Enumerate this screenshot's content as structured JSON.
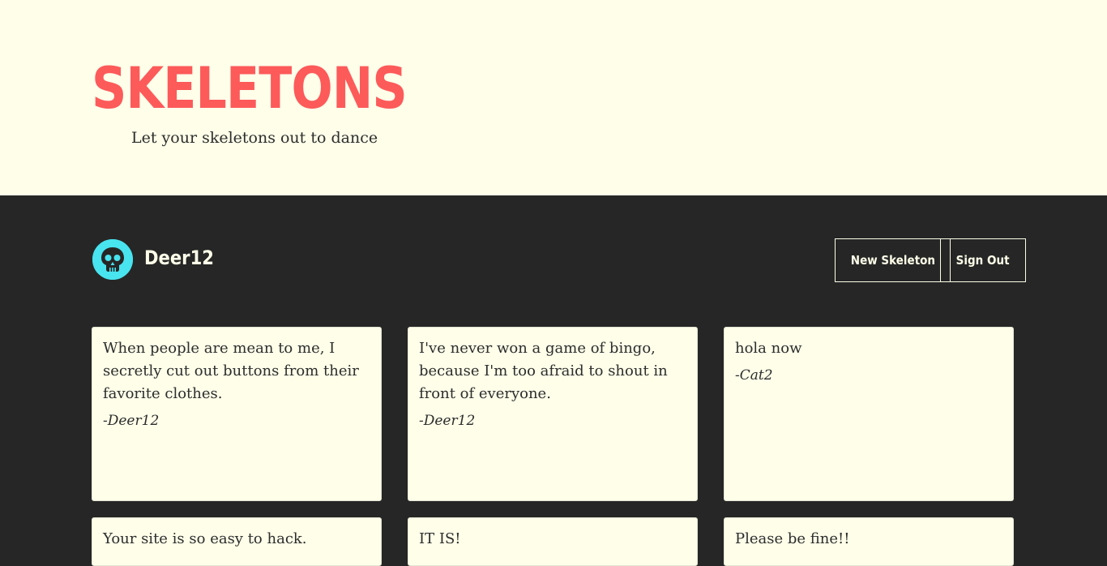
{
  "header": {
    "title": "SKELETONS",
    "tagline": "Let your skeletons out to dance"
  },
  "user": {
    "name": "Deer12",
    "avatar_icon": "skull-icon",
    "avatar_color": "#48e4f0"
  },
  "actions": {
    "new_skeleton": "New Skeleton",
    "sign_out": "Sign Out"
  },
  "colors": {
    "brand": "#fd5a5a",
    "header_bg": "#fefee9",
    "main_bg": "#262626"
  },
  "skeletons": [
    {
      "text": "When people are mean to me, I secretly cut out buttons from their favorite clothes.",
      "author": "-Deer12"
    },
    {
      "text": "I've never won a game of bingo, because I'm too afraid to shout in front of everyone.",
      "author": "-Deer12"
    },
    {
      "text": "hola now",
      "author": "-Cat2"
    },
    {
      "text": "Your site is so easy to hack.",
      "author": ""
    },
    {
      "text": "IT IS!",
      "author": ""
    },
    {
      "text": "Please be fine!!",
      "author": ""
    }
  ]
}
